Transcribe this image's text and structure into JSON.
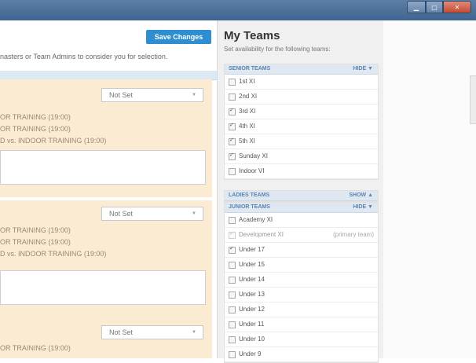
{
  "window": {
    "min_icon": "minimize-icon",
    "max_icon": "maximize-icon",
    "close_icon": "close-icon"
  },
  "main": {
    "save_label": "Save Changes",
    "intro": "nasters or Team Admins to consider you for selection.",
    "cards": [
      {
        "select": "Not Set",
        "lines": [
          "OR TRAINING (19:00)",
          "OR TRAINING (19:00)",
          "D vs. INDOOR TRAINING (19:00)"
        ]
      },
      {
        "select": "Not Set",
        "lines": [
          "OR TRAINING (19:00)",
          "OR TRAINING (19:00)",
          "D vs. INDOOR TRAINING (19:00)"
        ]
      },
      {
        "select": "Not Set",
        "lines": [
          "OR TRAINING (19:00)"
        ]
      }
    ]
  },
  "panel": {
    "title": "My Teams",
    "subtitle": "Set availability for the following teams:",
    "senior": {
      "title": "SENIOR TEAMS",
      "toggle": "HIDE ▼",
      "teams": [
        {
          "name": "1st XI",
          "checked": false
        },
        {
          "name": "2nd XI",
          "checked": false
        },
        {
          "name": "3rd XI",
          "checked": true
        },
        {
          "name": "4th XI",
          "checked": true
        },
        {
          "name": "5th XI",
          "checked": true
        },
        {
          "name": "Sunday XI",
          "checked": true
        },
        {
          "name": "Indoor VI",
          "checked": false
        }
      ]
    },
    "ladies": {
      "title": "LADIES TEAMS",
      "toggle": "SHOW ▲"
    },
    "junior": {
      "title": "JUNIOR TEAMS",
      "toggle": "HIDE ▼",
      "teams": [
        {
          "name": "Academy XI",
          "checked": false
        },
        {
          "name": "Development XI",
          "checked": true,
          "disabled": true,
          "note": "(primary team)"
        },
        {
          "name": "Under 17",
          "checked": true
        },
        {
          "name": "Under 15",
          "checked": false
        },
        {
          "name": "Under 14",
          "checked": false
        },
        {
          "name": "Under 13",
          "checked": false
        },
        {
          "name": "Under 12",
          "checked": false
        },
        {
          "name": "Under 11",
          "checked": false
        },
        {
          "name": "Under 10",
          "checked": false
        },
        {
          "name": "Under 9",
          "checked": false
        }
      ]
    }
  }
}
